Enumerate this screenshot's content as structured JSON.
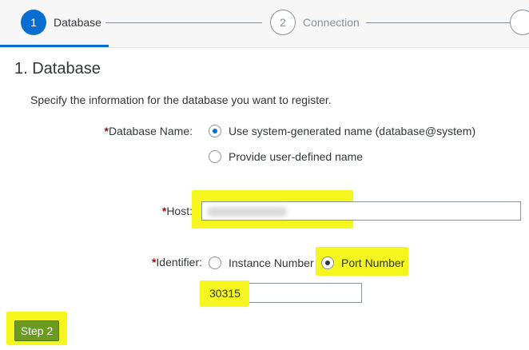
{
  "wizard": {
    "steps": [
      {
        "number": "1",
        "label": "Database"
      },
      {
        "number": "2",
        "label": "Connection"
      }
    ]
  },
  "page": {
    "title": "1. Database",
    "intro": "Specify the information for the database you want to register."
  },
  "form": {
    "database_name": {
      "label": "Database Name:",
      "required_mark": "*",
      "options": [
        {
          "label": "Use system-generated name (database@system)",
          "selected": true
        },
        {
          "label": "Provide user-defined name",
          "selected": false
        }
      ]
    },
    "host": {
      "label": "Host:",
      "required_mark": "*",
      "value": ""
    },
    "identifier": {
      "label": "Identifier:",
      "required_mark": "*",
      "options": [
        {
          "label": "Instance Number",
          "selected": false
        },
        {
          "label": "Port Number",
          "selected": true
        }
      ],
      "port_value": "30315"
    }
  },
  "actions": {
    "step2_label": "Step 2"
  },
  "colors": {
    "accent": "#0a6ed1",
    "highlight": "#f5f51f",
    "required": "#bb0000",
    "button": "#6b9b1e"
  }
}
